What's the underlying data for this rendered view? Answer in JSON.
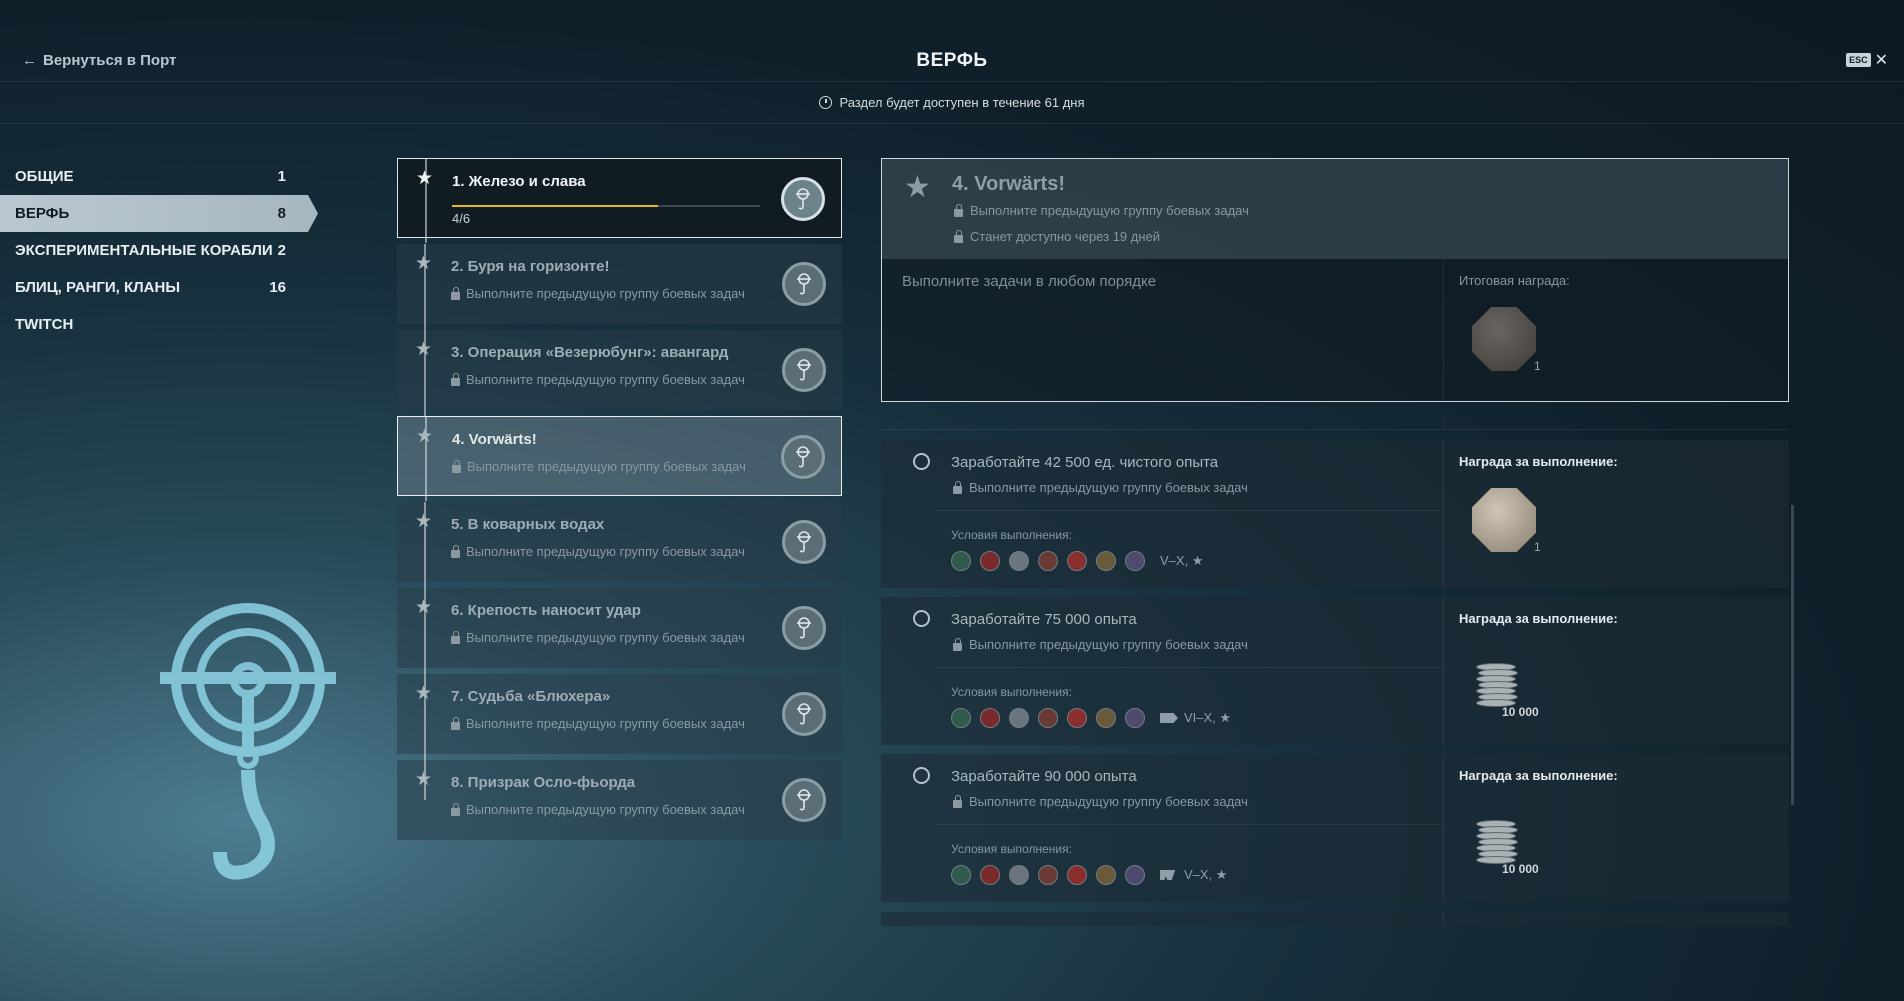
{
  "header": {
    "back_label": "Вернуться в Порт",
    "title": "ВЕРФЬ",
    "esc_label": "ESC",
    "close_symbol": "✕"
  },
  "notice": {
    "icon": "clock-icon",
    "text": "Раздел будет доступен в течение 61 дня"
  },
  "categories": [
    {
      "label": "ОБЩИЕ",
      "count": "1"
    },
    {
      "label": "ВЕРФЬ",
      "count": "8",
      "active": true
    },
    {
      "label": "ЭКСПЕРИМЕНТАЛЬНЫЕ КОРАБЛИ",
      "count": "2"
    },
    {
      "label": "БЛИЦ, РАНГИ, КЛАНЫ",
      "count": "16"
    },
    {
      "label": "TWITCH",
      "count": ""
    }
  ],
  "groups": [
    {
      "title": "1. Железо и слава",
      "progress_text": "4/6",
      "progress": 0.67,
      "state": "active"
    },
    {
      "title": "2. Буря на горизонте!",
      "sub": "Выполните предыдущую группу боевых задач",
      "state": "locked"
    },
    {
      "title": "3. Операция «Везерюбунг»: авангард",
      "sub": "Выполните предыдущую группу боевых задач",
      "state": "locked"
    },
    {
      "title": "4. Vorwärts!",
      "sub": "Выполните предыдущую группу боевых задач",
      "state": "selected"
    },
    {
      "title": "5. В коварных водах",
      "sub": "Выполните предыдущую группу боевых задач",
      "state": "locked"
    },
    {
      "title": "6. Крепость наносит удар",
      "sub": "Выполните предыдущую группу боевых задач",
      "state": "locked"
    },
    {
      "title": "7. Судьба «Блюхера»",
      "sub": "Выполните предыдущую группу боевых задач",
      "state": "locked"
    },
    {
      "title": "8. Призрак Осло-фьорда",
      "sub": "Выполните предыдущую группу боевых задач",
      "state": "locked"
    }
  ],
  "detail": {
    "title": "4. Vorwärts!",
    "lock1": "Выполните предыдущую группу боевых задач",
    "lock2": "Станет доступно через 19 дней",
    "any_order": "Выполните задачи в любом порядке",
    "final_reward_label": "Итоговая награда:",
    "final_reward_count": "1"
  },
  "tasks": [
    {
      "title": "Заработайте 42 500 ед. чистого опыта",
      "lock": "Выполните предыдущую группу боевых задач",
      "cond_label": "Условия выполнения:",
      "tier": "V–X, ★",
      "class_icon": "",
      "reward_label": "Награда за выполнение:",
      "reward_type": "medal",
      "reward_value": "1"
    },
    {
      "title": "Заработайте 75 000 опыта",
      "lock": "Выполните предыдущую группу боевых задач",
      "cond_label": "Условия выполнения:",
      "tier": "VI–X, ★",
      "class_icon": "destroyer-class-icon",
      "reward_label": "Награда за выполнение:",
      "reward_type": "credits",
      "reward_value": "10 000"
    },
    {
      "title": "Заработайте 90 000 опыта",
      "lock": "Выполните предыдущую группу боевых задач",
      "cond_label": "Условия выполнения:",
      "tier": "V–X, ★",
      "class_icon": "cruiser-class-icon",
      "reward_label": "Награда за выполнение:",
      "reward_type": "credits",
      "reward_value": "10 000"
    }
  ],
  "nation_flags": [
    "#2f5a4c",
    "#7a2a2a",
    "#6b7580",
    "#6a3a35",
    "#8a2e2e",
    "#6b5a3a",
    "#4d4a6e"
  ]
}
